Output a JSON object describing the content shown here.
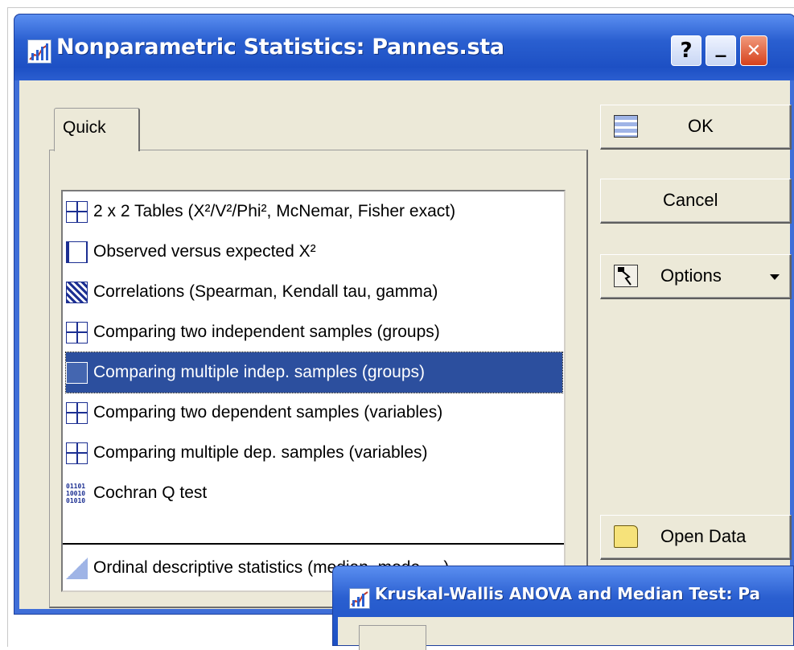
{
  "window": {
    "title": "Nonparametric Statistics: Pannes.sta",
    "help_label": "?",
    "minimize_label": "_",
    "close_label": "✕"
  },
  "tabs": [
    {
      "label": "Quick"
    }
  ],
  "analyses": [
    {
      "label": "2 x 2 Tables (X²/V²/Phi², McNemar, Fisher exact)",
      "icon": "two-by-two-table-icon"
    },
    {
      "label": "Observed versus expected X²",
      "icon": "observed-expected-icon"
    },
    {
      "label": "Correlations (Spearman, Kendall tau, gamma)",
      "icon": "correlation-matrix-icon"
    },
    {
      "label": "Comparing two independent samples (groups)",
      "icon": "two-independent-icon"
    },
    {
      "label": "Comparing multiple indep. samples (groups)",
      "icon": "multiple-independent-icon",
      "selected": true
    },
    {
      "label": "Comparing two dependent samples (variables)",
      "icon": "two-dependent-icon"
    },
    {
      "label": "Comparing multiple dep. samples (variables)",
      "icon": "multiple-dependent-icon"
    },
    {
      "label": "Cochran Q test",
      "icon": "binary-data-icon"
    },
    {
      "label": "Ordinal descriptive statistics (median, mode, ...)",
      "icon": "ordinal-chart-icon"
    }
  ],
  "buttons": {
    "ok": "OK",
    "cancel": "Cancel",
    "options": "Options",
    "open_data": "Open Data"
  },
  "second_window": {
    "title": "Kruskal-Wallis ANOVA and Median Test: Pa"
  },
  "colors": {
    "titlebar": "#2a5fd0",
    "selection": "#2c4f9e",
    "face": "#ece9d8"
  }
}
